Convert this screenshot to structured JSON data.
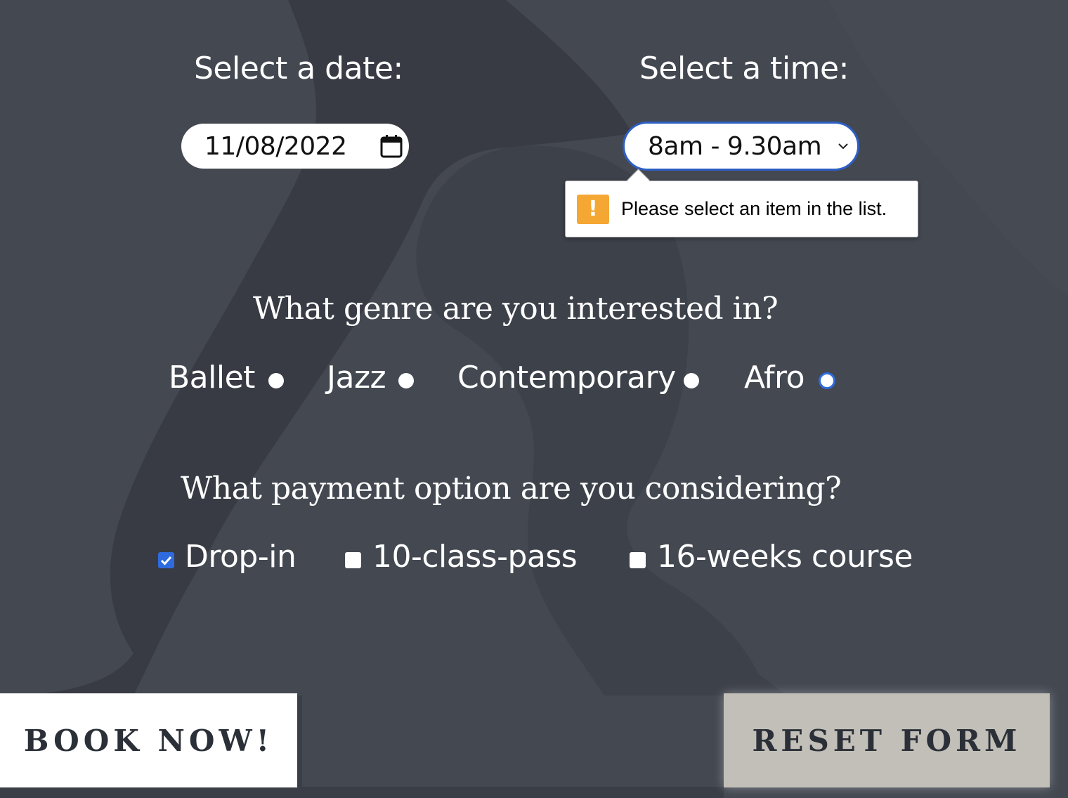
{
  "form": {
    "date_label": "Select a date:",
    "date_value": "11/08/2022",
    "time_label": "Select a time:",
    "time_value": "8am - 9.30am",
    "validation_message": "Please select an item in the list.",
    "validation_icon": "!",
    "genre_question": "What genre are you interested in?",
    "genres": [
      {
        "label": "Ballet"
      },
      {
        "label": "Jazz"
      },
      {
        "label": "Contemporary"
      },
      {
        "label": "Afro",
        "focused": true
      }
    ],
    "payment_question": "What payment option are you considering?",
    "payments": [
      {
        "label": "Drop-in",
        "checked": true
      },
      {
        "label": "10-class-pass",
        "checked": false
      },
      {
        "label": "16-weeks course",
        "checked": false
      }
    ],
    "book_label": "BOOK NOW!",
    "reset_label": "RESET FORM"
  },
  "colors": {
    "background": "#434851",
    "focus_blue": "#2f6bde",
    "warning": "#f5a733",
    "reset_button": "#c2bfb8"
  },
  "icons": [
    "calendar-icon",
    "chevron-down-icon",
    "warning-icon",
    "checkmark-icon"
  ]
}
